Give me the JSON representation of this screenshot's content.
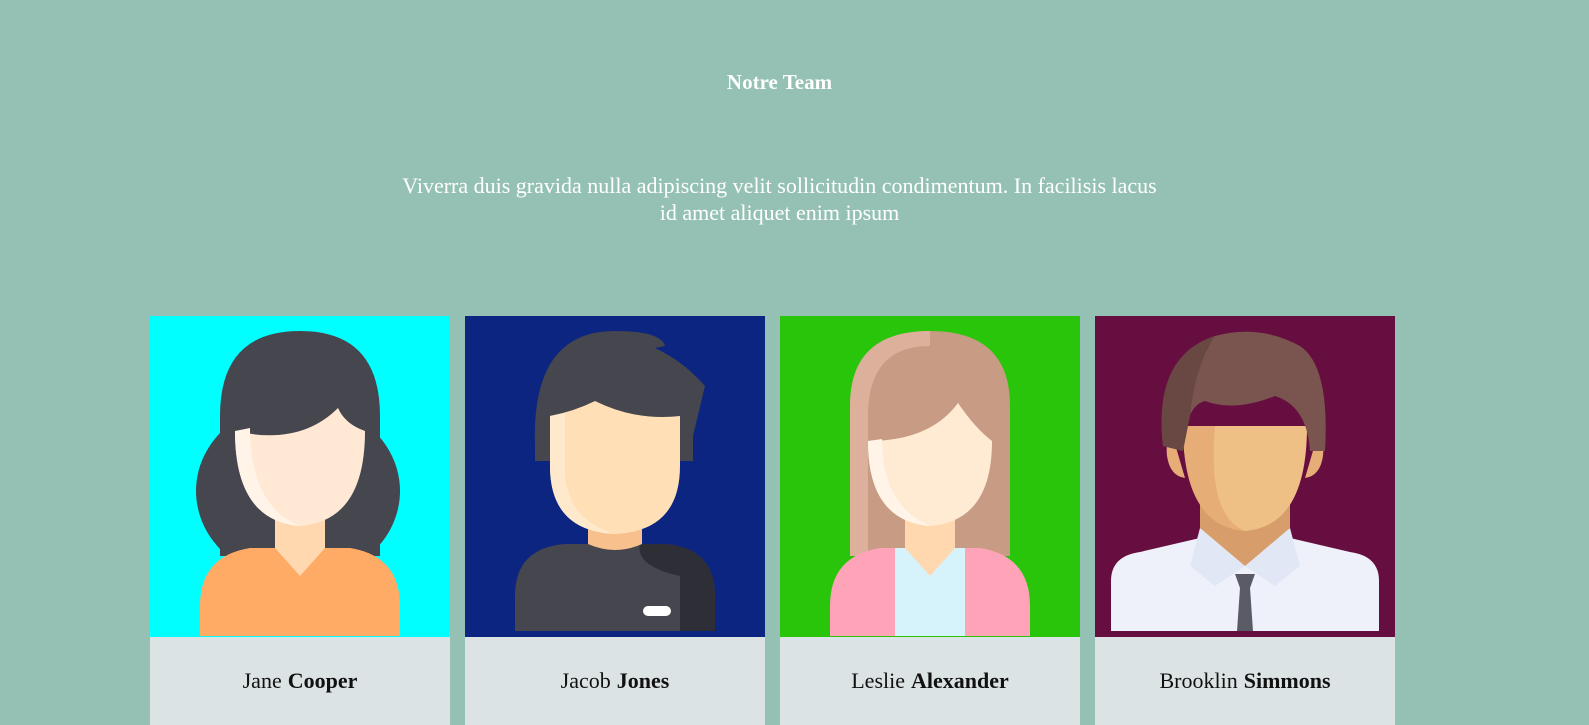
{
  "title": "Notre Team",
  "intro": "Viverra duis gravida nulla adipiscing velit sollicitudin condimentum. In facilisis lacus id amet aliquet enim ipsum",
  "members": [
    {
      "first": "Jane",
      "last": "Cooper",
      "bg": "#00ffff",
      "avatar": "woman-dark-hair-avatar"
    },
    {
      "first": "Jacob",
      "last": "Jones",
      "bg": "#0b2580",
      "avatar": "man-dark-hair-avatar"
    },
    {
      "first": "Leslie",
      "last": "Alexander",
      "bg": "#28c50a",
      "avatar": "woman-blonde-hair-avatar"
    },
    {
      "first": "Brooklin",
      "last": "Simmons",
      "bg": "#670e40",
      "avatar": "man-tie-avatar"
    }
  ]
}
